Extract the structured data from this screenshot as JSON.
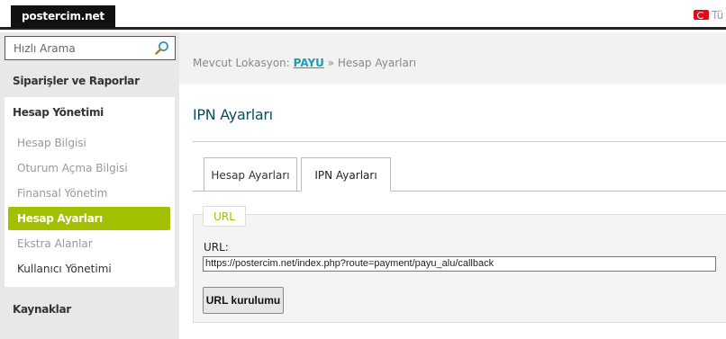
{
  "topbar": {
    "brand": "postercim.net",
    "language": "Tü"
  },
  "sidebar": {
    "search_placeholder": "Hızlı Arama",
    "section_orders": "Siparişler ve Raporlar",
    "account_menu": {
      "title": "Hesap Yönetimi",
      "items": [
        {
          "label": "Hesap Bilgisi",
          "state": "normal"
        },
        {
          "label": "Oturum Açma Bilgisi",
          "state": "normal"
        },
        {
          "label": "Finansal Yönetim",
          "state": "normal"
        },
        {
          "label": "Hesap Ayarları",
          "state": "active"
        },
        {
          "label": "Ekstra Alanlar",
          "state": "normal"
        },
        {
          "label": "Kullanıcı Yönetimi",
          "state": "dark"
        }
      ]
    },
    "section_resources": "Kaynaklar"
  },
  "breadcrumb": {
    "prefix": "Mevcut Lokasyon:",
    "link": "PAYU",
    "separator": "»",
    "current": "Hesap Ayarları"
  },
  "page": {
    "title": "IPN Ayarları",
    "tabs": [
      {
        "label": "Hesap Ayarları",
        "active": false
      },
      {
        "label": "IPN Ayarları",
        "active": true
      }
    ],
    "panel": {
      "section_tab": "URL",
      "url_label": "URL:",
      "url_value": "https://postercim.net/index.php?route=payment/payu_alu/callback",
      "button_label": "URL kurulumu"
    }
  },
  "colors": {
    "accent": "#a2c000",
    "link": "#1aa0b5",
    "title": "#0d4a5c",
    "flag": "#e30a17"
  }
}
